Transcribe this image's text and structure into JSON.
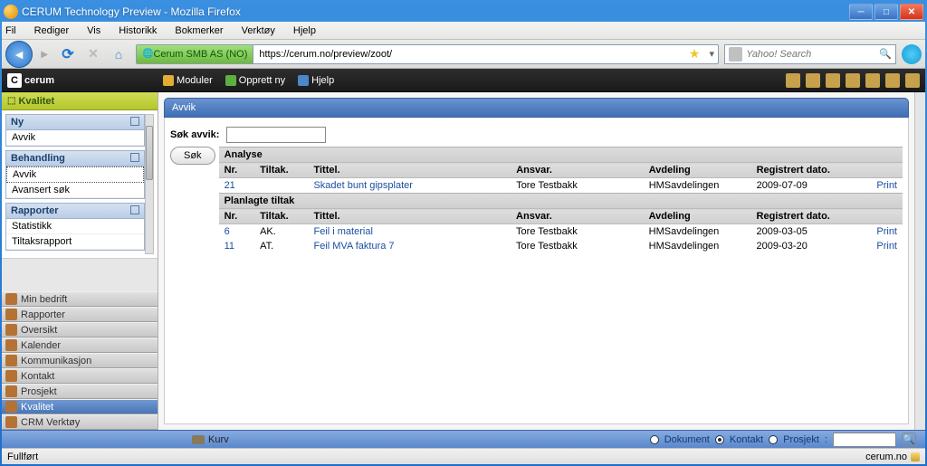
{
  "window": {
    "title": "CERUM Technology Preview - Mozilla Firefox"
  },
  "ff_menu": {
    "file": "Fil",
    "edit": "Rediger",
    "view": "Vis",
    "history": "Historikk",
    "bookmarks": "Bokmerker",
    "tools": "Verktøy",
    "help": "Hjelp"
  },
  "url_badge": "Cerum SMB AS (NO)",
  "url": "https://cerum.no/preview/zoot/",
  "search_placeholder": "Yahoo! Search",
  "logo": "cerum",
  "topmenu": {
    "moduler": "Moduler",
    "opprett": "Opprett ny",
    "hjelp": "Hjelp"
  },
  "sidebar": {
    "kvalitet_hdr": "Kvalitet",
    "ny": {
      "hdr": "Ny",
      "items": [
        "Avvik"
      ]
    },
    "behandling": {
      "hdr": "Behandling",
      "items": [
        "Avvik",
        "Avansert søk"
      ]
    },
    "rapporter": {
      "hdr": "Rapporter",
      "items": [
        "Statistikk",
        "Tiltaksrapport"
      ]
    },
    "accordion": [
      "Min bedrift",
      "Rapporter",
      "Oversikt",
      "Kalender",
      "Kommunikasjon",
      "Kontakt",
      "Prosjekt",
      "Kvalitet",
      "CRM Verktøy"
    ]
  },
  "main": {
    "title": "Avvik",
    "search_label": "Søk avvik:",
    "search_btn": "Søk",
    "sec_analyse": "Analyse",
    "sec_plan": "Planlagte tiltak",
    "cols": {
      "nr": "Nr.",
      "tiltak": "Tiltak.",
      "tittel": "Tittel.",
      "ansvar": "Ansvar.",
      "avdeling": "Avdeling",
      "dato": "Registrert dato."
    },
    "print": "Print",
    "analyse_rows": [
      {
        "nr": "21",
        "tiltak": "",
        "tittel": "Skadet bunt gipsplater",
        "ansvar": "Tore Testbakk",
        "avd": "HMSavdelingen",
        "dato": "2009-07-09"
      }
    ],
    "plan_rows": [
      {
        "nr": "6",
        "tiltak": "AK.",
        "tittel": "Feil i material",
        "ansvar": "Tore Testbakk",
        "avd": "HMSavdelingen",
        "dato": "2009-03-05"
      },
      {
        "nr": "11",
        "tiltak": "AT.",
        "tittel": "Feil MVA faktura 7",
        "ansvar": "Tore Testbakk",
        "avd": "HMSavdelingen",
        "dato": "2009-03-20"
      }
    ]
  },
  "bluebar": {
    "kurv": "Kurv",
    "dokument": "Dokument",
    "kontakt": "Kontakt",
    "prosjekt": "Prosjekt"
  },
  "status": {
    "left": "Fullført",
    "right": "cerum.no"
  }
}
